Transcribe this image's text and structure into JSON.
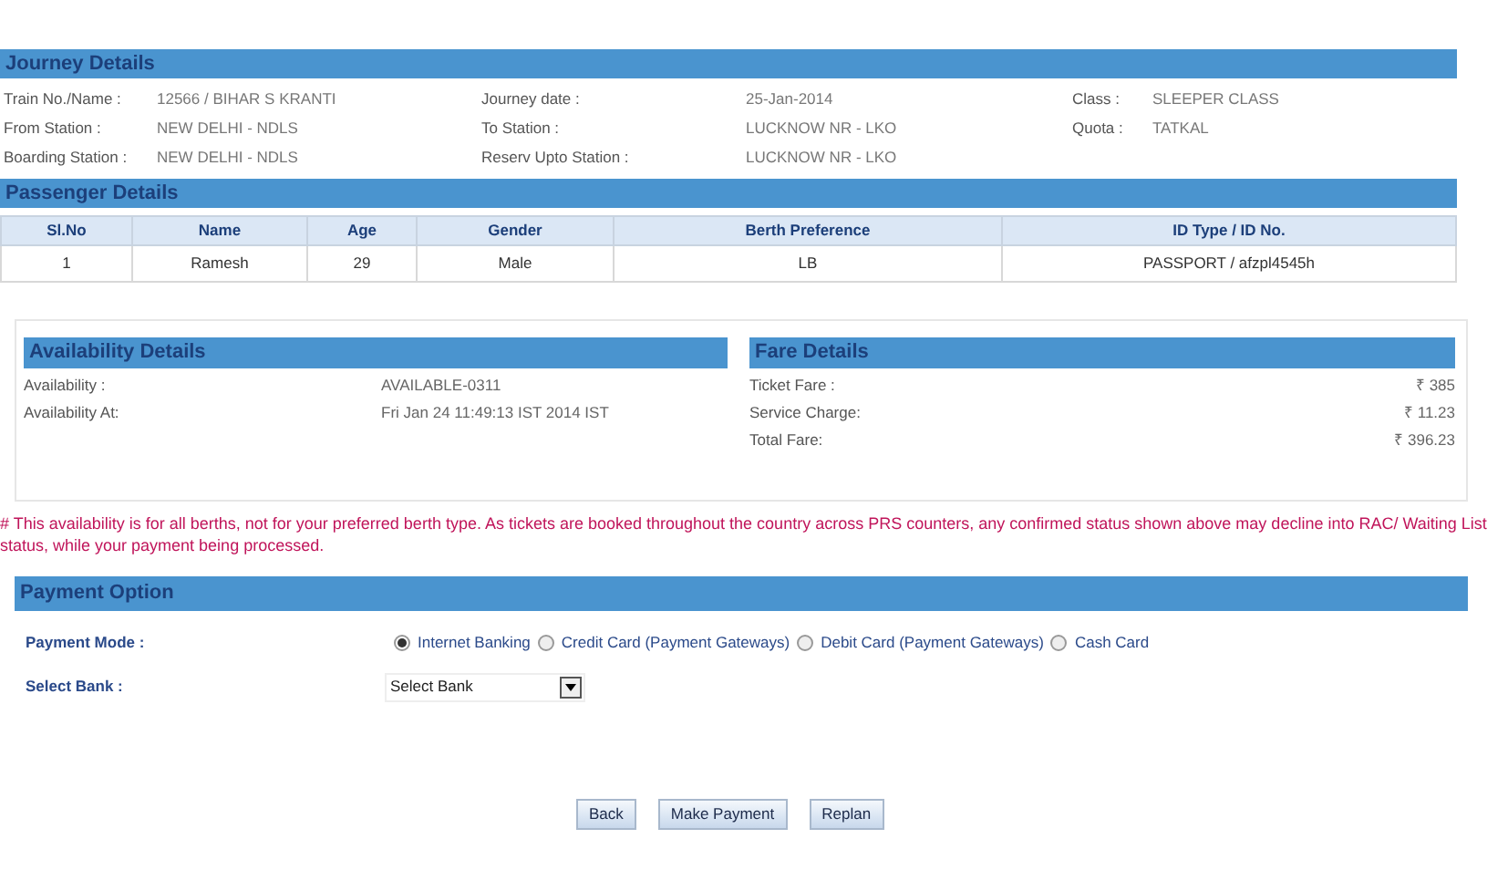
{
  "journey": {
    "title": "Journey Details",
    "fields": [
      {
        "label": "Train No./Name :",
        "value": "12566 / BIHAR S KRANTI"
      },
      {
        "label": "Journey date :",
        "value": "25-Jan-2014"
      },
      {
        "label": "Class :",
        "value": "SLEEPER CLASS"
      },
      {
        "label": "From Station :",
        "value": "NEW DELHI - NDLS"
      },
      {
        "label": "To Station :",
        "value": "LUCKNOW NR - LKO"
      },
      {
        "label": "Quota :",
        "value": "TATKAL"
      },
      {
        "label": "Boarding Station :",
        "value": "NEW DELHI - NDLS"
      },
      {
        "label": "Reserv Upto Station :",
        "value": "LUCKNOW NR - LKO"
      }
    ]
  },
  "passengers": {
    "title": "Passenger Details",
    "columns": [
      "Sl.No",
      "Name",
      "Age",
      "Gender",
      "Berth Preference",
      "ID Type / ID No."
    ],
    "rows": [
      [
        "1",
        "Ramesh",
        "29",
        "Male",
        "LB",
        "PASSPORT / afzpl4545h"
      ]
    ]
  },
  "availability": {
    "title": "Availability Details",
    "fields": [
      {
        "label": "Availability :",
        "value": "AVAILABLE-0311"
      },
      {
        "label": "Availability At:",
        "value": "Fri Jan 24 11:49:13 IST 2014 IST"
      }
    ]
  },
  "fare": {
    "title": "Fare Details",
    "fields": [
      {
        "label": "Ticket Fare :",
        "value": "₹ 385"
      },
      {
        "label": "Service Charge:",
        "value": "₹ 11.23"
      },
      {
        "label": "Total Fare:",
        "value": "₹ 396.23"
      }
    ]
  },
  "note": "# This availability is for all berths, not for your preferred berth type. As tickets are booked throughout the country across PRS counters, any confirmed status shown above may decline into RAC/ Waiting List status, while your payment being processed.",
  "payment": {
    "title": "Payment Option",
    "mode_label": "Payment Mode :",
    "modes": [
      {
        "label": "Internet Banking",
        "selected": true
      },
      {
        "label": "Credit Card (Payment Gateways)",
        "selected": false
      },
      {
        "label": "Debit Card (Payment Gateways)",
        "selected": false
      },
      {
        "label": "Cash Card",
        "selected": false
      }
    ],
    "bank_label": "Select Bank :",
    "bank_value": "Select Bank"
  },
  "buttons": [
    "Back",
    "Make Payment",
    "Replan"
  ]
}
